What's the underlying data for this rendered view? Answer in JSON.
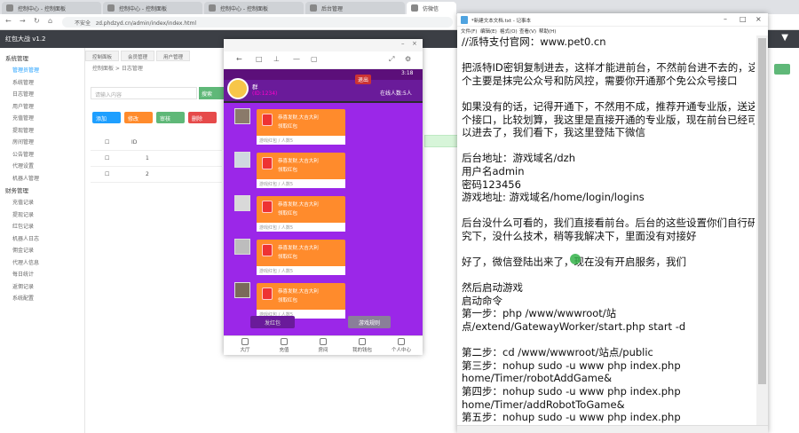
{
  "browser": {
    "tabs": [
      "控制中心 - 控制面板",
      "控制中心 - 控制面板",
      "控制中心 - 控制面板",
      "后台管理",
      "仿微信"
    ],
    "url": "zd.phdzyd.cn/admin/index/index.html",
    "security_label": "不安全"
  },
  "admin": {
    "title": "红包大战 v1.2",
    "top_tabs": [
      "控制面板",
      "会员管理",
      "用户管理"
    ],
    "breadcrumb": "控制面板 > 日志管理",
    "search_placeholder": "请输入内容",
    "search_button": "搜索",
    "action_buttons": [
      "添加",
      "修改",
      "审核",
      "删除"
    ],
    "table_header_id": "ID",
    "table_rows": [
      "1",
      "2"
    ],
    "sidebar": [
      {
        "type": "group",
        "label": "系统管理"
      },
      {
        "type": "item",
        "label": "管理员管理",
        "active": true
      },
      {
        "type": "item",
        "label": "系统管理"
      },
      {
        "type": "item",
        "label": "日志管理"
      },
      {
        "type": "item",
        "label": "用户管理"
      },
      {
        "type": "item",
        "label": "充值管理"
      },
      {
        "type": "item",
        "label": "提现管理"
      },
      {
        "type": "item",
        "label": "房间管理"
      },
      {
        "type": "item",
        "label": "公告管理"
      },
      {
        "type": "item",
        "label": "代理设置"
      },
      {
        "type": "item",
        "label": "机器人管理"
      },
      {
        "type": "group",
        "label": "财务管理"
      },
      {
        "type": "item",
        "label": "充值记录"
      },
      {
        "type": "item",
        "label": "提现记录"
      },
      {
        "type": "item",
        "label": "红包记录"
      },
      {
        "type": "item",
        "label": "机器人日志"
      },
      {
        "type": "item",
        "label": "佣金记录"
      },
      {
        "type": "item",
        "label": "代理人信息"
      },
      {
        "type": "item",
        "label": "每日统计"
      },
      {
        "type": "item",
        "label": "返佣记录"
      },
      {
        "type": "item",
        "label": "系统配置"
      }
    ]
  },
  "phone": {
    "exit_label": "退出",
    "clock": "3:18",
    "room_name": "群",
    "room_id": "(ID:1234)",
    "online": "在线人数:5人",
    "messages": [
      {
        "title": "恭喜发财,大吉大利",
        "sub": "领取红包",
        "foot": "游戏红包 / 人数5"
      },
      {
        "title": "恭喜发财,大吉大利",
        "sub": "领取红包",
        "foot": "游戏红包 / 人数5"
      },
      {
        "title": "恭喜发财,大吉大利",
        "sub": "领取红包",
        "foot": "游戏红包 / 人数5"
      },
      {
        "title": "恭喜发财,大吉大利",
        "sub": "领取红包",
        "foot": "游戏红包 / 人数5"
      },
      {
        "title": "恭喜发财,大吉大利",
        "sub": "领取红包",
        "foot": "游戏红包 / 人数5"
      }
    ],
    "button_left": "发红包",
    "button_right": "游戏规则",
    "tabs": [
      "大厅",
      "充值",
      "房间",
      "我的钱包",
      "个人中心"
    ]
  },
  "notepad": {
    "title": "*新建文本文档.txt - 记事本",
    "menu": [
      "文件(F)",
      "编辑(E)",
      "格式(O)",
      "查看(V)",
      "帮助(H)"
    ],
    "lines": [
      "//派特支付官网：www.pet0.cn",
      "",
      "把派特ID密钥复制进去，这样才能进前台，不然前台进不去的，这",
      "个主要是抹完公众号和防风控，需要你开通那个免公众号接口",
      "",
      "如果没有的话，记得开通下，不然用不成，推荐开通专业版，送这",
      "个接口，比较划算，我这里是直接开通的专业版，现在前台已经可",
      "以进去了，我们看下，我这里登陆下微信",
      "",
      "后台地址：游戏域名/dzh",
      "用户名admin",
      "密码123456",
      "游戏地址: 游戏域名/home/login/logins",
      "",
      "后台没什么可看的，我们直接看前台。后台的这些设置你们自行研",
      "究下，没什么技术，稍等我解决下，里面没有对接好",
      "",
      "好了，微信登陆出来了，现在没有开启服务，我们",
      "",
      "然后启动游戏",
      "启动命令",
      "第一步：php /www/wwwroot/站",
      "点/extend/GatewayWorker/start.php start -d",
      "",
      "第二步：cd /www/wwwroot/站点/public",
      "第三步：nohup sudo -u www php index.php",
      "home/Timer/robotAddGame&",
      "第四步：nohup sudo -u www php index.php",
      "home/Timer/addRobotToGame&",
      "第五步：nohup sudo -u www php index.php"
    ]
  },
  "colors": {
    "purple": "#9b27e8",
    "header_dark": "#3c3f45",
    "accent_green": "#5fb878",
    "redpacket": "#ff8b2c"
  }
}
